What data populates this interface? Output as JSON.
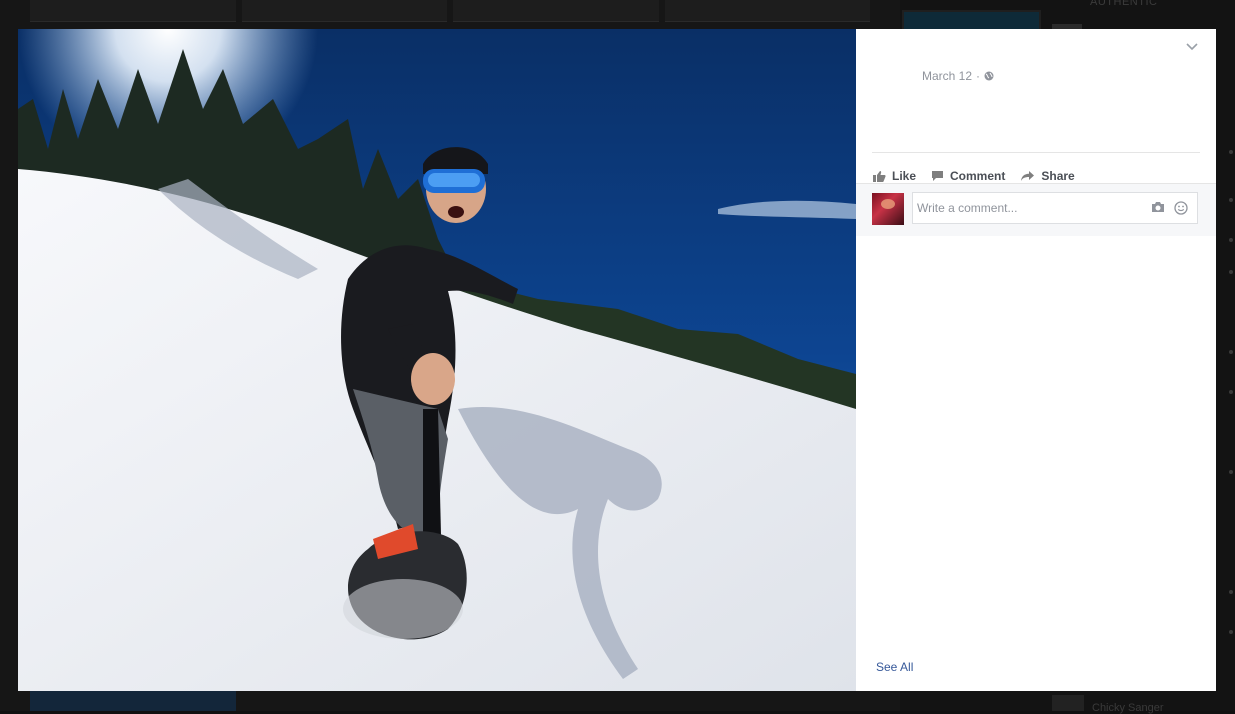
{
  "background": {
    "sidebar_heading": "AUTHENTIC",
    "bottom_label": "Chicky Sanger"
  },
  "post": {
    "date": "March 12",
    "separator": "·",
    "privacy_icon": "globe-icon"
  },
  "actions": {
    "like_label": "Like",
    "comment_label": "Comment",
    "share_label": "Share"
  },
  "comment_box": {
    "placeholder": "Write a comment...",
    "camera_icon": "camera-icon",
    "emoji_icon": "smiley-icon"
  },
  "footer": {
    "see_all_label": "See All"
  },
  "colors": {
    "link": "#365899",
    "sky": "#0b3a7a",
    "snow": "#eef1f6"
  }
}
